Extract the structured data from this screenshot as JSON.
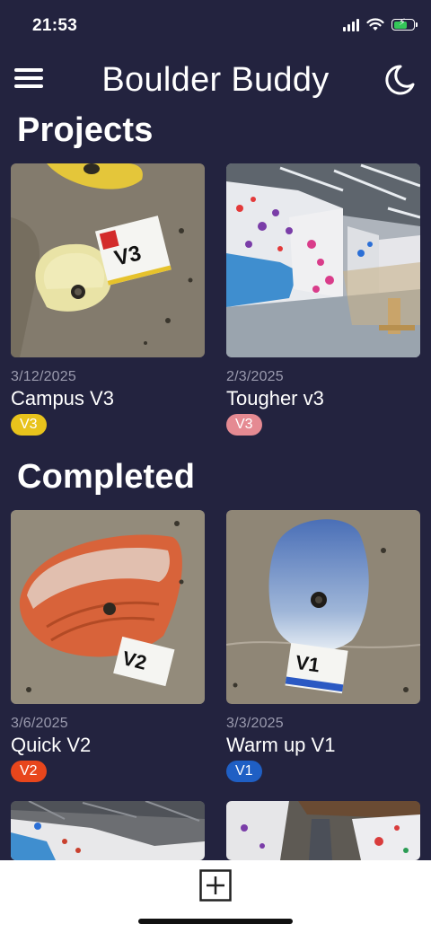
{
  "status": {
    "time": "21:53"
  },
  "header": {
    "title": "Boulder Buddy",
    "menu_icon": "hamburger-icon",
    "theme_icon": "moon-icon"
  },
  "sections": {
    "projects": {
      "title": "Projects",
      "cards": [
        {
          "date": "3/12/2025",
          "name": "Campus V3",
          "grade": "V3",
          "grade_color": "#e8c31c"
        },
        {
          "date": "2/3/2025",
          "name": "Tougher v3",
          "grade": "V3",
          "grade_color": "#e58a92"
        }
      ]
    },
    "completed": {
      "title": "Completed",
      "cards": [
        {
          "date": "3/6/2025",
          "name": "Quick V2",
          "grade": "V2",
          "grade_color": "#e8461c"
        },
        {
          "date": "3/3/2025",
          "name": "Warm up V1",
          "grade": "V1",
          "grade_color": "#1f5fc4"
        }
      ]
    }
  },
  "photo_labels": {
    "campus": "V3",
    "quick": "V2",
    "warmup": "V1"
  },
  "bottom_bar": {
    "add_icon": "add-square-icon"
  },
  "colors": {
    "background": "#23233f",
    "bottom_bar": "#ffffff",
    "muted_text": "#9a9aae"
  }
}
